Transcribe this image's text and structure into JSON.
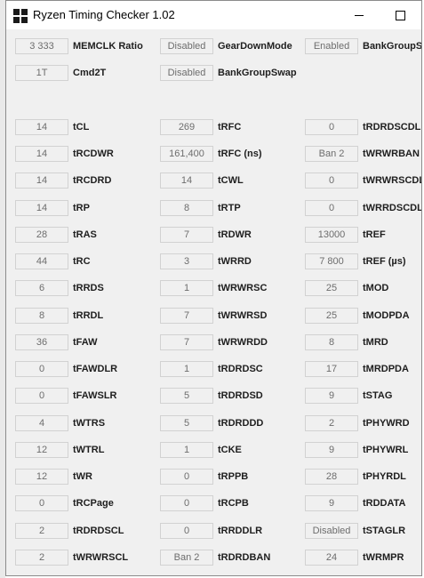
{
  "window": {
    "title": "Ryzen Timing Checker 1.02"
  },
  "rows": [
    [
      {
        "value": "3 333",
        "label": "MEMCLK Ratio"
      },
      {
        "value": "Disabled",
        "label": "GearDownMode"
      },
      {
        "value": "Enabled",
        "label": "BankGroupSwa"
      }
    ],
    [
      {
        "value": "1T",
        "label": "Cmd2T"
      },
      {
        "value": "Disabled",
        "label": "BankGroupSwap"
      },
      null
    ],
    null,
    [
      {
        "value": "14",
        "label": "tCL"
      },
      {
        "value": "269",
        "label": "tRFC"
      },
      {
        "value": "0",
        "label": "tRDRDSCDLR"
      }
    ],
    [
      {
        "value": "14",
        "label": "tRCDWR"
      },
      {
        "value": "161,400",
        "label": "tRFC (ns)"
      },
      {
        "value": "Ban 2",
        "label": "tWRWRBAN"
      }
    ],
    [
      {
        "value": "14",
        "label": "tRCDRD"
      },
      {
        "value": "14",
        "label": "tCWL"
      },
      {
        "value": "0",
        "label": "tWRWRSCDLR"
      }
    ],
    [
      {
        "value": "14",
        "label": "tRP"
      },
      {
        "value": "8",
        "label": "tRTP"
      },
      {
        "value": "0",
        "label": "tWRRDSCDLR"
      }
    ],
    [
      {
        "value": "28",
        "label": "tRAS"
      },
      {
        "value": "7",
        "label": "tRDWR"
      },
      {
        "value": "13000",
        "label": "tREF"
      }
    ],
    [
      {
        "value": "44",
        "label": "tRC"
      },
      {
        "value": "3",
        "label": "tWRRD"
      },
      {
        "value": "7 800",
        "label": "tREF (µs)"
      }
    ],
    [
      {
        "value": "6",
        "label": "tRRDS"
      },
      {
        "value": "1",
        "label": "tWRWRSC"
      },
      {
        "value": "25",
        "label": "tMOD"
      }
    ],
    [
      {
        "value": "8",
        "label": "tRRDL"
      },
      {
        "value": "7",
        "label": "tWRWRSD"
      },
      {
        "value": "25",
        "label": "tMODPDA"
      }
    ],
    [
      {
        "value": "36",
        "label": "tFAW"
      },
      {
        "value": "7",
        "label": "tWRWRDD"
      },
      {
        "value": "8",
        "label": "tMRD"
      }
    ],
    [
      {
        "value": "0",
        "label": "tFAWDLR"
      },
      {
        "value": "1",
        "label": "tRDRDSC"
      },
      {
        "value": "17",
        "label": "tMRDPDA"
      }
    ],
    [
      {
        "value": "0",
        "label": "tFAWSLR"
      },
      {
        "value": "5",
        "label": "tRDRDSD"
      },
      {
        "value": "9",
        "label": "tSTAG"
      }
    ],
    [
      {
        "value": "4",
        "label": "tWTRS"
      },
      {
        "value": "5",
        "label": "tRDRDDD"
      },
      {
        "value": "2",
        "label": "tPHYWRD"
      }
    ],
    [
      {
        "value": "12",
        "label": "tWTRL"
      },
      {
        "value": "1",
        "label": "tCKE"
      },
      {
        "value": "9",
        "label": "tPHYWRL"
      }
    ],
    [
      {
        "value": "12",
        "label": "tWR"
      },
      {
        "value": "0",
        "label": "tRPPB"
      },
      {
        "value": "28",
        "label": "tPHYRDL"
      }
    ],
    [
      {
        "value": "0",
        "label": "tRCPage"
      },
      {
        "value": "0",
        "label": "tRCPB"
      },
      {
        "value": "9",
        "label": "tRDDATA"
      }
    ],
    [
      {
        "value": "2",
        "label": "tRDRDSCL"
      },
      {
        "value": "0",
        "label": "tRRDDLR"
      },
      {
        "value": "Disabled",
        "label": "tSTAGLR"
      }
    ],
    [
      {
        "value": "2",
        "label": "tWRWRSCL"
      },
      {
        "value": "Ban 2",
        "label": "tRDRDBAN"
      },
      {
        "value": "24",
        "label": "tWRMPR"
      }
    ]
  ]
}
